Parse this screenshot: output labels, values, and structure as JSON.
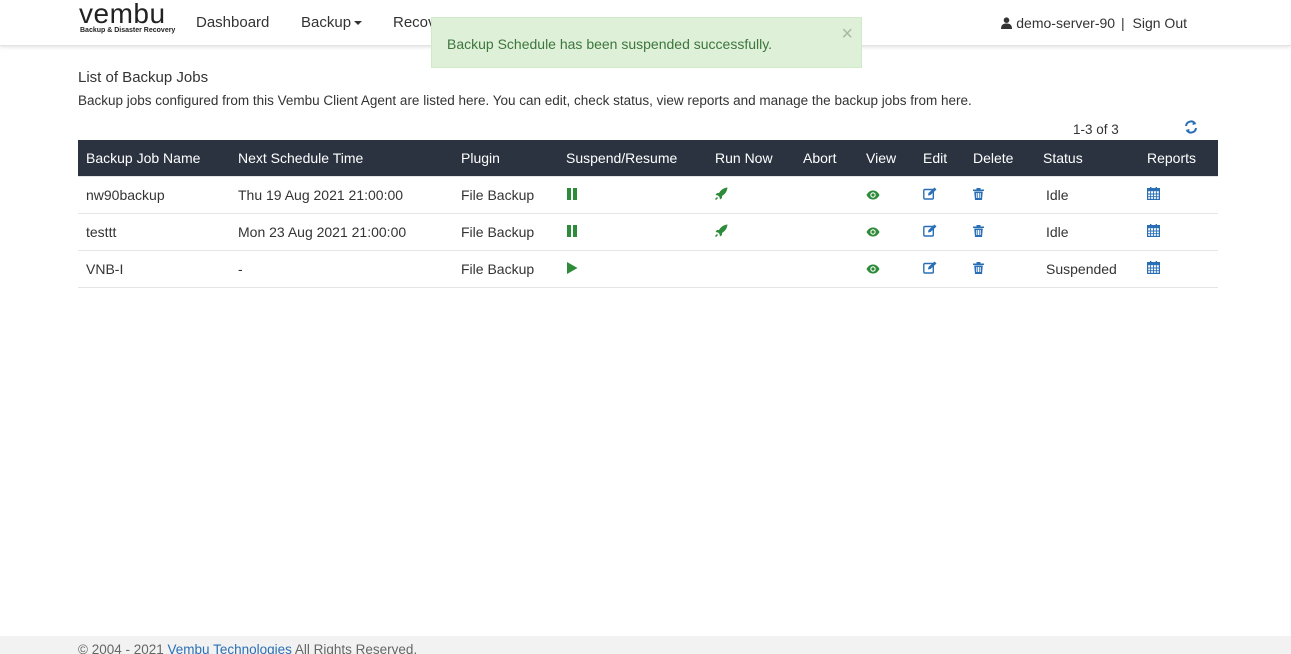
{
  "brand": {
    "name": "vembu",
    "tagline": "Backup & Disaster Recovery"
  },
  "nav": {
    "dashboard": "Dashboard",
    "backup": "Backup",
    "recovery": "Recov"
  },
  "user": {
    "name": "demo-server-90",
    "separator": "|",
    "signout": "Sign Out"
  },
  "alert": {
    "message": "Backup Schedule has been suspended successfully.",
    "close": "×"
  },
  "page": {
    "title": "List of Backup Jobs",
    "description": "Backup jobs configured from this Vembu Client Agent are listed here. You can edit, check status, view reports and manage the backup jobs from here."
  },
  "pager": {
    "text": "1-3 of 3"
  },
  "table": {
    "headers": {
      "name": "Backup Job Name",
      "schedule": "Next Schedule Time",
      "plugin": "Plugin",
      "suspend": "Suspend/Resume",
      "runnow": "Run Now",
      "abort": "Abort",
      "view": "View",
      "edit": "Edit",
      "delete": "Delete",
      "status": "Status",
      "reports": "Reports"
    },
    "rows": [
      {
        "name": "nw90backup",
        "schedule": "Thu 19 Aug 2021 21:00:00",
        "plugin": "File Backup",
        "status": "Idle",
        "suspend_icon": "pause-icon"
      },
      {
        "name": "testtt",
        "schedule": "Mon 23 Aug 2021 21:00:00",
        "plugin": "File Backup",
        "status": "Idle",
        "suspend_icon": "pause-icon"
      },
      {
        "name": "VNB-I",
        "schedule": "-",
        "plugin": "File Backup",
        "status": "Suspended",
        "suspend_icon": "play-icon"
      }
    ]
  },
  "footer": {
    "copyright": "© 2004 - 2021",
    "company": "Vembu Technologies",
    "rights": "All Rights Reserved."
  },
  "colors": {
    "header_bg": "#2b3340",
    "green_icon": "#2e8b3a",
    "blue_icon": "#2a6fb5",
    "alert_bg": "#dff0d8",
    "alert_text": "#3c763d"
  }
}
